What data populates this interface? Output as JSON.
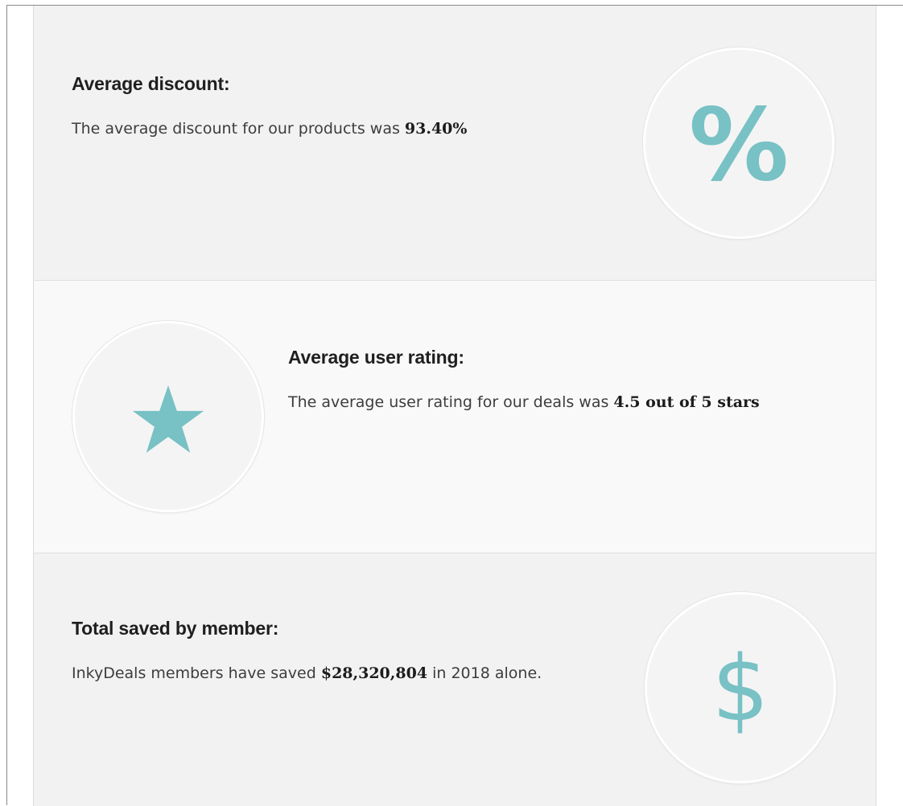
{
  "sections": [
    {
      "title": "Average discount:",
      "text_before": "The average discount for our products was ",
      "highlight": "93.40%",
      "text_after": "",
      "icon": "percent-icon",
      "icon_glyph": "%"
    },
    {
      "title": "Average user rating:",
      "text_before": "The average user rating for our deals was ",
      "highlight": "4.5 out of 5 stars",
      "text_after": "",
      "icon": "star-icon"
    },
    {
      "title": "Total saved by member:",
      "text_before": "InkyDeals members have saved ",
      "highlight": "$28,320,804",
      "text_after": " in 2018 alone.",
      "icon": "dollar-icon",
      "icon_glyph": "$"
    }
  ],
  "colors": {
    "accent": "#78c1c5",
    "section_dark": "#f2f2f2",
    "section_light": "#f9f9f9"
  }
}
